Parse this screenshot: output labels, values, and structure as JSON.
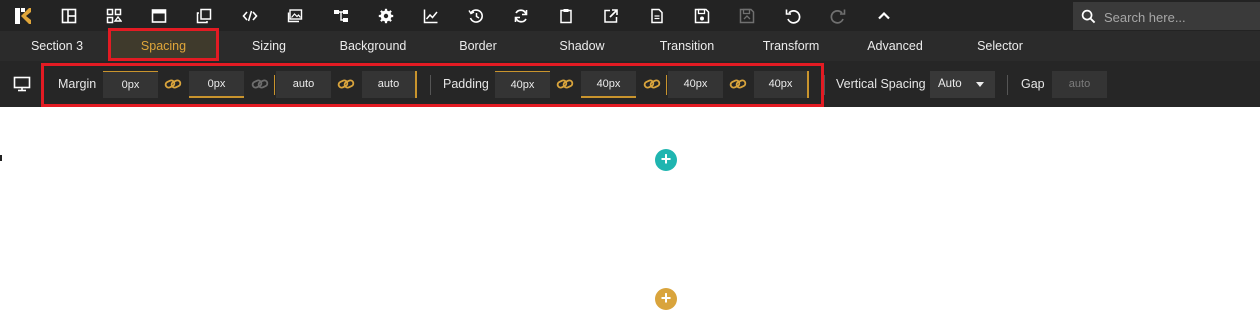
{
  "toolbar": {
    "logo_icon": "kadence-logo",
    "icons": [
      "layout-icon",
      "widgets-icon",
      "window-icon",
      "copy-icon",
      "code-icon",
      "gallery-icon",
      "sitemap-icon",
      "settings-icon",
      "chart-icon",
      "history-icon",
      "refresh-icon",
      "clipboard-icon",
      "external-edit-icon",
      "document-icon",
      "save-icon",
      "save-disabled-icon",
      "undo-icon",
      "redo-disabled-icon",
      "chevron-up-icon"
    ],
    "search_placeholder": "Search here..."
  },
  "tabs": [
    "Section 3",
    "Spacing",
    "Sizing",
    "Background",
    "Border",
    "Shadow",
    "Transition",
    "Transform",
    "Advanced",
    "Selector"
  ],
  "active_tab": "Spacing",
  "spacing": {
    "margin_label": "Margin",
    "margin": [
      "0px",
      "0px",
      "auto",
      "auto"
    ],
    "padding_label": "Padding",
    "padding": [
      "40px",
      "40px",
      "40px",
      "40px"
    ],
    "vertical_spacing_label": "Vertical Spacing",
    "vertical_spacing_value": "Auto",
    "gap_label": "Gap",
    "gap_placeholder": "auto"
  },
  "canvas": {
    "add_buttons": [
      "+",
      "+"
    ]
  },
  "colors": {
    "accent_gold": "#e0a63a",
    "highlight_red": "#e31b23",
    "add_teal": "#1fb5b0",
    "add_gold": "#d9a43c"
  }
}
